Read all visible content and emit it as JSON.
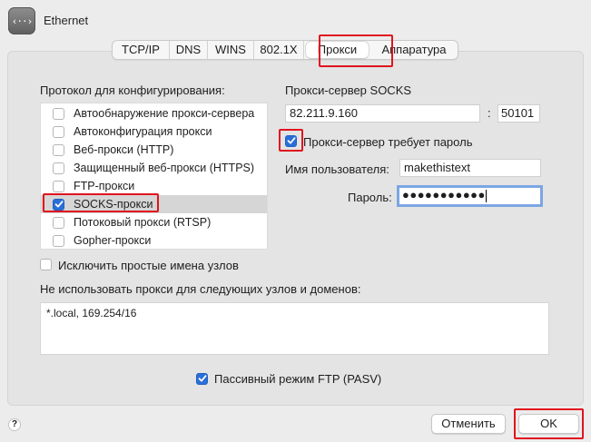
{
  "window": {
    "title": "Ethernet",
    "icon": "network-icon",
    "icon_glyph": "‹··›"
  },
  "tabs": [
    {
      "label": "TCP/IP",
      "active": false
    },
    {
      "label": "DNS",
      "active": false
    },
    {
      "label": "WINS",
      "active": false
    },
    {
      "label": "802.1X",
      "active": false
    },
    {
      "label": "Прокси",
      "active": true
    },
    {
      "label": "Аппаратура",
      "active": false
    }
  ],
  "protocols": {
    "header": "Протокол для конфигурирования:",
    "items": [
      {
        "label": "Автообнаружение прокси-сервера",
        "checked": false,
        "selected": false
      },
      {
        "label": "Автоконфигурация прокси",
        "checked": false,
        "selected": false
      },
      {
        "label": "Веб-прокси (HTTP)",
        "checked": false,
        "selected": false
      },
      {
        "label": "Защищенный веб-прокси (HTTPS)",
        "checked": false,
        "selected": false
      },
      {
        "label": "FTP-прокси",
        "checked": false,
        "selected": false
      },
      {
        "label": "SOCKS-прокси",
        "checked": true,
        "selected": true
      },
      {
        "label": "Потоковый прокси (RTSP)",
        "checked": false,
        "selected": false
      },
      {
        "label": "Gopher-прокси",
        "checked": false,
        "selected": false
      }
    ]
  },
  "socks": {
    "header": "Прокси-сервер SOCKS",
    "server": "82.211.9.160",
    "separator": ":",
    "port": "50101",
    "requires_password_label": "Прокси-сервер требует пароль",
    "requires_password": true,
    "username_label": "Имя пользователя:",
    "username": "makethistext",
    "password_label": "Пароль:",
    "password_masked": "●●●●●●●●●●●"
  },
  "exclude_simple": {
    "label": "Исключить простые имена узлов",
    "checked": false
  },
  "bypass": {
    "label": "Не использовать прокси для следующих узлов и доменов:",
    "value": "*.local, 169.254/16"
  },
  "passive_ftp": {
    "label": "Пассивный режим FTP (PASV)",
    "checked": true
  },
  "buttons": {
    "help": "?",
    "cancel": "Отменить",
    "ok": "OK"
  },
  "colors": {
    "accent": "#2a6fd6",
    "highlight": "#e0141e",
    "focus": "#7ba6e4"
  }
}
